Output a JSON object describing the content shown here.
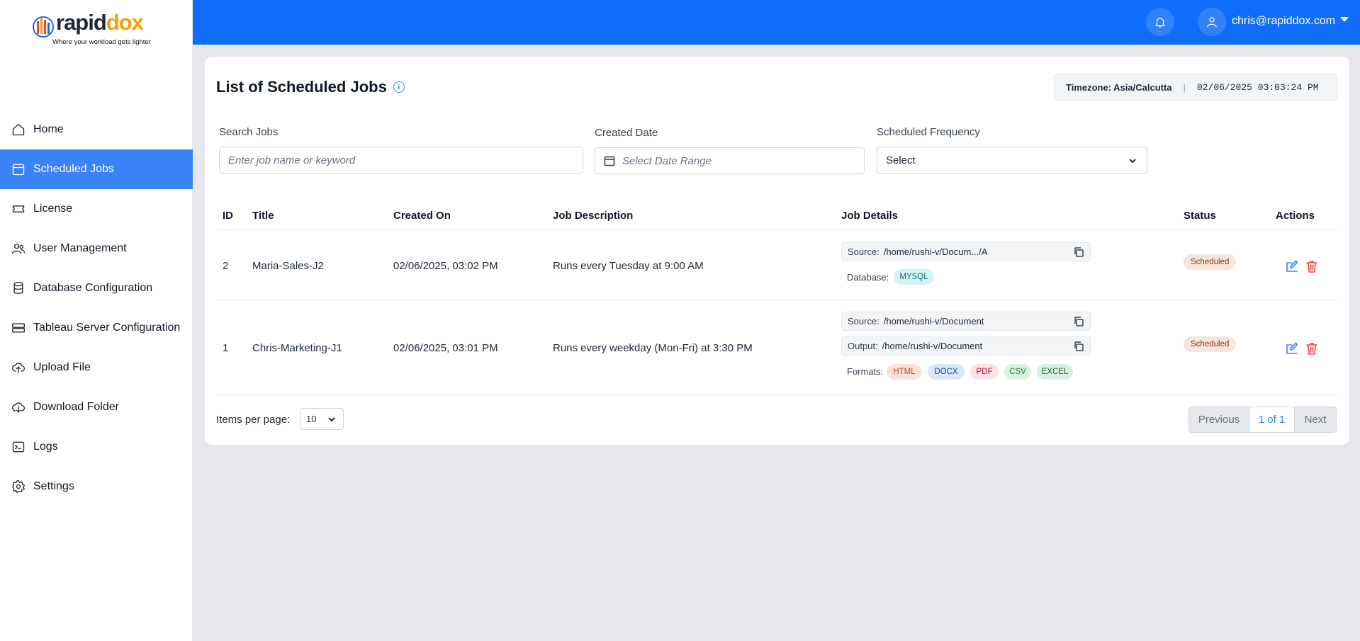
{
  "brand": {
    "name_part1": "rapid",
    "name_part2": "dox",
    "tagline": "Where your workload gets lighter"
  },
  "sidebar": {
    "items": [
      {
        "label": "Home",
        "icon": "home-icon"
      },
      {
        "label": "Scheduled Jobs",
        "icon": "calendar-icon",
        "active": true
      },
      {
        "label": "License",
        "icon": "ticket-icon"
      },
      {
        "label": "User Management",
        "icon": "users-icon"
      },
      {
        "label": "Database Configuration",
        "icon": "database-icon"
      },
      {
        "label": "Tableau Server Configuration",
        "icon": "server-icon"
      },
      {
        "label": "Upload File",
        "icon": "cloud-upload-icon"
      },
      {
        "label": "Download Folder",
        "icon": "cloud-download-icon"
      },
      {
        "label": "Logs",
        "icon": "terminal-icon"
      },
      {
        "label": "Settings",
        "icon": "gear-icon"
      }
    ]
  },
  "header": {
    "user_email": "chris@rapiddox.com"
  },
  "page": {
    "title": "List of Scheduled Jobs",
    "timezone_label": "Timezone: Asia/Calcutta",
    "timezone_separator": "|",
    "current_time": "02/06/2025 03:03:24 PM"
  },
  "filters": {
    "search_label": "Search Jobs",
    "search_placeholder": "Enter job name or keyword",
    "date_label": "Created Date",
    "date_placeholder": "Select Date Range",
    "frequency_label": "Scheduled Frequency",
    "frequency_value": "Select"
  },
  "table": {
    "headers": {
      "id": "ID",
      "title": "Title",
      "created": "Created On",
      "desc": "Job Description",
      "details": "Job Details",
      "status": "Status",
      "actions": "Actions"
    },
    "rows": [
      {
        "id": "2",
        "title": "Maria-Sales-J2",
        "created": "02/06/2025, 03:02 PM",
        "description": "Runs every Tuesday at 9:00 AM",
        "source_label": "Source:",
        "source": "/home/rushi-v/Docum.../A",
        "database_label": "Database:",
        "database": "MYSQL",
        "status": "Scheduled"
      },
      {
        "id": "1",
        "title": "Chris-Marketing-J1",
        "created": "02/06/2025, 03:01 PM",
        "description": "Runs every weekday (Mon-Fri) at 3:30 PM",
        "source_label": "Source:",
        "source": "/home/rushi-v/Document",
        "output_label": "Output:",
        "output": "/home/rushi-v/Document",
        "formats_label": "Formats:",
        "formats": [
          "HTML",
          "DOCX",
          "PDF",
          "CSV",
          "EXCEL"
        ],
        "status": "Scheduled"
      }
    ]
  },
  "footer": {
    "items_per_page_label": "Items per page:",
    "items_per_page_value": "10",
    "prev_label": "Previous",
    "page_indicator": "1 of 1",
    "next_label": "Next"
  },
  "colors": {
    "accent": "#0f6dfa",
    "active_nav": "#3b82f6",
    "status_bg": "#f3e6dc",
    "status_text": "#8b3a1a"
  }
}
